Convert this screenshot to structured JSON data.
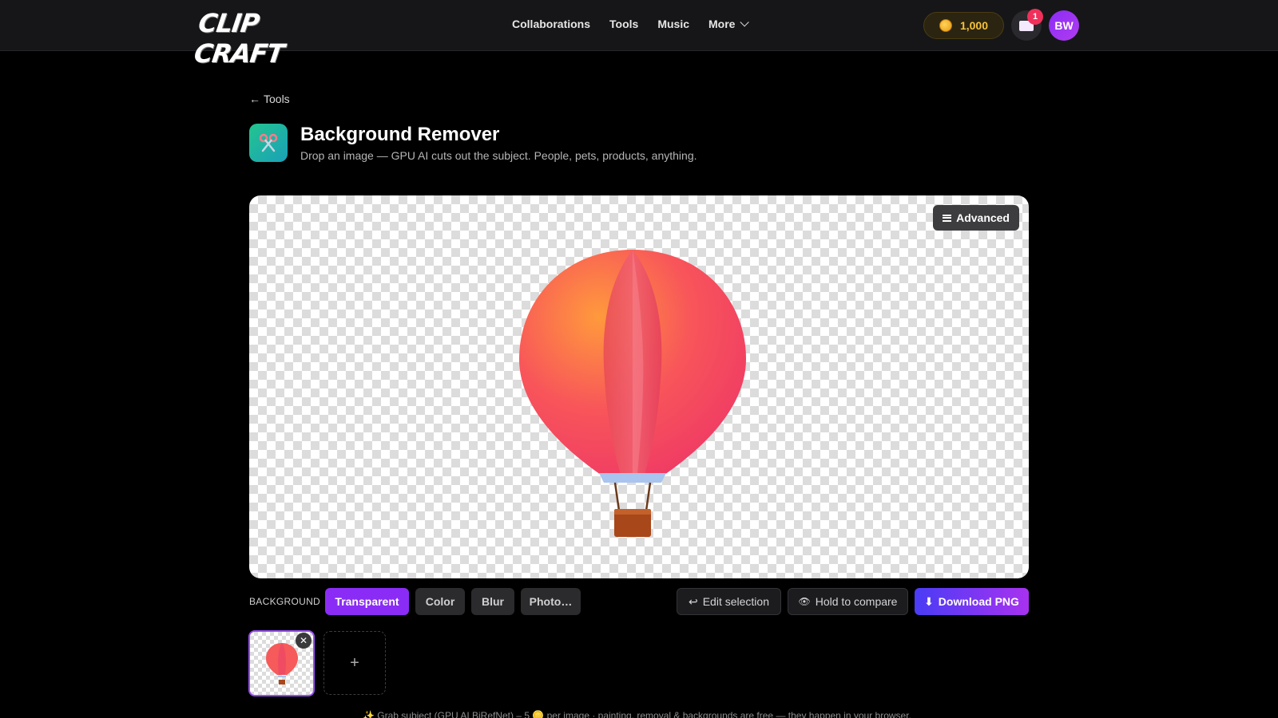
{
  "brand": {
    "logo_text": "CLIP CRAFT"
  },
  "nav": {
    "links": [
      "Collaborations",
      "Tools",
      "Music"
    ],
    "more_label": "More",
    "coins": "1,000",
    "notification_count": "1",
    "avatar_initials": "BW"
  },
  "header": {
    "back_label": "Tools",
    "title": "Background Remover",
    "subtitle": "Drop an image — GPU AI cuts out the subject. People, pets, products, anything."
  },
  "canvas": {
    "advanced_label": "Advanced"
  },
  "toolbar": {
    "background_label": "BACKGROUND",
    "options": [
      "Transparent",
      "Color",
      "Blur",
      "Photo…"
    ],
    "selected": "Transparent",
    "edit_selection": "Edit selection",
    "hold_compare": "Hold to compare",
    "download": "Download PNG"
  },
  "thumbnails": {
    "add_label": "+"
  },
  "footnote": "✨ Grab subject (GPU AI BiRefNet) – 5 🪙 per image · painting, removal & backgrounds are free — they happen in your browser.",
  "colors": {
    "accent": "#8a2cf5",
    "coin": "#f5c23b",
    "badge": "#f0305a"
  }
}
